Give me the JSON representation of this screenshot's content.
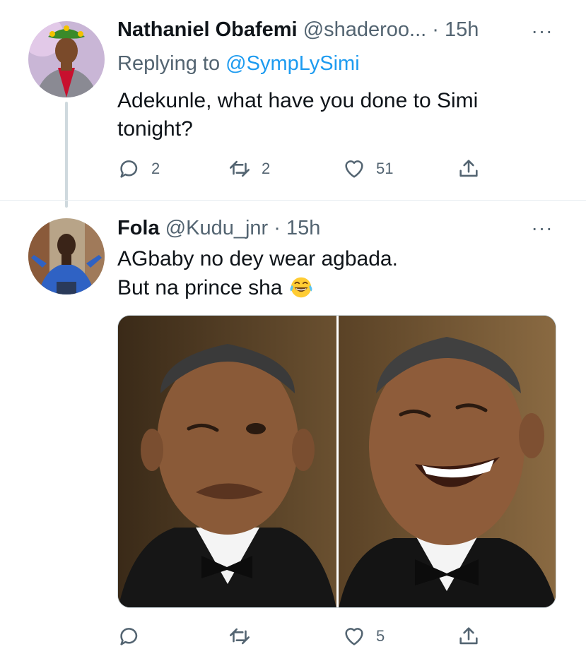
{
  "tweets": [
    {
      "display_name": "Nathaniel Obafemi",
      "handle": "@shaderoo...",
      "separator": "·",
      "time": "15h",
      "replying_label": "Replying to",
      "replying_to": "@SympLySimi",
      "text_line1": "Adekunle, what have you done to Simi",
      "text_line2": "tonight?",
      "replies": "2",
      "retweets": "2",
      "likes": "51"
    },
    {
      "display_name": "Fola",
      "handle": "@Kudu_jnr",
      "separator": "·",
      "time": "15h",
      "text_line1": "AGbaby no dey wear agbada.",
      "text_line2": "But na prince sha",
      "emoji": "laughing-with-tears-icon",
      "likes": "5"
    }
  ],
  "more_glyph": "···",
  "colors": {
    "link": "#1d9bf0",
    "muted": "#536471",
    "divider": "#e6ecf0"
  }
}
